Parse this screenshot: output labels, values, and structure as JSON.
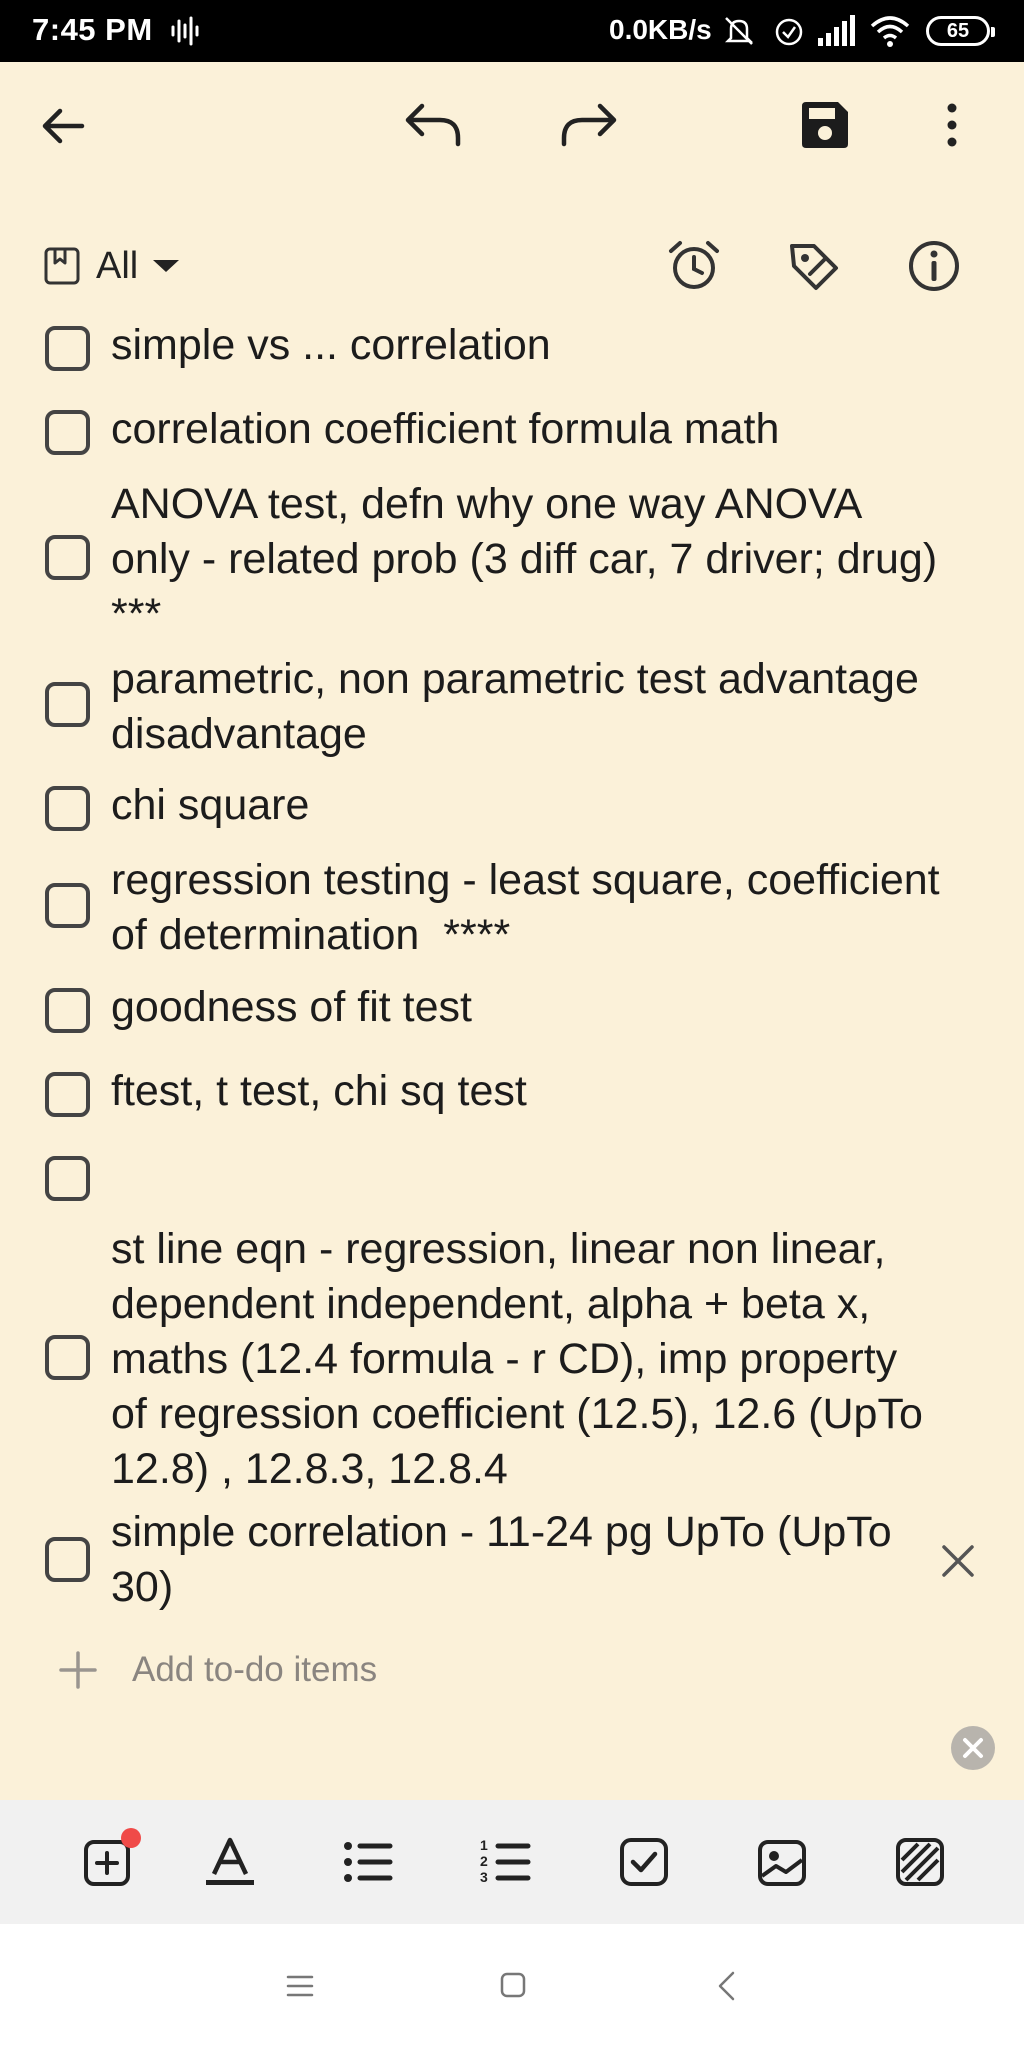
{
  "status_bar": {
    "time": "7:45 PM",
    "network_speed": "0.0KB/s",
    "battery_level": "65",
    "icons": [
      "audio-wave-icon",
      "silent-bell-icon",
      "alarm-icon",
      "signal-icon",
      "wifi-icon",
      "battery-icon"
    ]
  },
  "top_toolbar": {
    "icons": [
      "back-arrow-icon",
      "undo-icon",
      "redo-icon",
      "save-icon",
      "more-vert-icon"
    ]
  },
  "filter": {
    "label": "All",
    "icons": [
      "notebook-icon",
      "dropdown-caret-icon",
      "alarm-clock-icon",
      "tag-icon",
      "info-icon"
    ]
  },
  "todos": [
    {
      "text": "simple vs ... correlation",
      "checked": false
    },
    {
      "text": "correlation coefficient formula math",
      "checked": false
    },
    {
      "text": "ANOVA test, defn why one way ANOVA only - related prob (3 diff car, 7 driver; drug) ***",
      "checked": false
    },
    {
      "text": "parametric, non parametric test advantage disadvantage",
      "checked": false
    },
    {
      "text": "chi square",
      "checked": false
    },
    {
      "text": "regression testing - least square, coefficient of determination  ****",
      "checked": false
    },
    {
      "text": "goodness of fit test",
      "checked": false
    },
    {
      "text": "ftest, t test, chi sq test",
      "checked": false
    },
    {
      "text": "",
      "checked": false
    },
    {
      "text": "st line eqn - regression, linear non linear, dependent independent, alpha + beta x, maths (12.4 formula - r CD), imp property of regression coefficient (12.5), 12.6 (UpTo 12.8) , 12.8.3, 12.8.4",
      "checked": false
    },
    {
      "text": "simple correlation - 11-24 pg UpTo (UpTo 30)",
      "checked": false
    }
  ],
  "add_item": {
    "label": "Add to-do items"
  },
  "bottom_tools": {
    "icons": [
      "add-box-icon",
      "text-format-icon",
      "bullet-list-icon",
      "numbered-list-icon",
      "checkbox-icon",
      "image-icon",
      "pattern-icon"
    ]
  },
  "nav_bar": {
    "icons": [
      "menu-icon",
      "home-icon",
      "back-icon"
    ]
  },
  "colors": {
    "page_background": "#fbf1d9",
    "status_bar": "#000000",
    "bottom_toolbar": "#f1f1f1",
    "notification_dot": "#f04a48"
  }
}
